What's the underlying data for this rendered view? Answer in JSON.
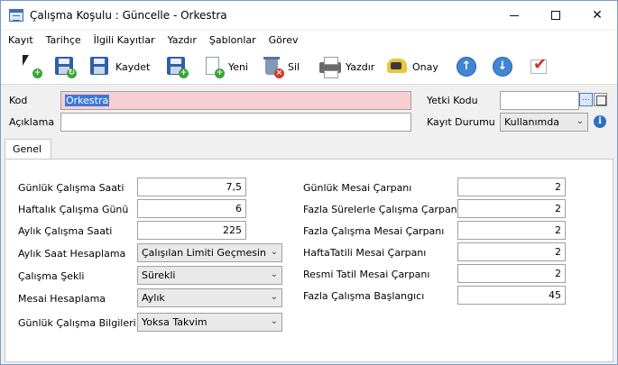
{
  "window": {
    "title": "Çalışma Koşulu : Güncelle - Orkestra",
    "min_icon": "minimize-icon",
    "max_icon": "maximize-icon",
    "close_icon": "close-icon"
  },
  "menu": [
    "Kayıt",
    "Tarihçe",
    "İlgili Kayıtlar",
    "Yazdır",
    "Şablonlar",
    "Görev"
  ],
  "toolbar": {
    "kaydet": "Kaydet",
    "yeni": "Yeni",
    "sil": "Sil",
    "yazdir": "Yazdır",
    "onay": "Onay"
  },
  "header": {
    "kod_label": "Kod",
    "kod_value": "Orkestra",
    "aciklama_label": "Açıklama",
    "aciklama_value": "",
    "yetki_label": "Yetki Kodu",
    "yetki_value": "",
    "durum_label": "Kayıt Durumu",
    "durum_value": "Kullanımda",
    "ellipsis": "...",
    "info": "i"
  },
  "tab": "Genel",
  "left": {
    "gunluk_saat_label": "Günlük Çalışma Saati",
    "gunluk_saat_value": "7,5",
    "haftalik_gun_label": "Haftalık Çalışma Günü",
    "haftalik_gun_value": "6",
    "aylik_saat_label": "Aylık Çalışma Saati",
    "aylik_saat_value": "225",
    "aylik_hesap_label": "Aylık Saat Hesaplama",
    "aylik_hesap_value": "Çalışılan Limiti Geçmesin",
    "calisma_sekli_label": "Çalışma Şekli",
    "calisma_sekli_value": "Sürekli",
    "mesai_hesap_label": "Mesai Hesaplama",
    "mesai_hesap_value": "Aylık",
    "gunluk_bilgi_label": "Günlük Çalışma Bilgileri",
    "gunluk_bilgi_value": "Yoksa Takvim"
  },
  "right": {
    "gunluk_mesai_label": "Günlük Mesai Çarpanı",
    "gunluk_mesai_value": "2",
    "fazla_sure_label": "Fazla Sürelerle Çalışma Çarpanı",
    "fazla_sure_value": "2",
    "fazla_mesai_label": "Fazla Çalışma Mesai Çarpanı",
    "fazla_mesai_value": "2",
    "hafta_tatili_label": "HaftaTatili Mesai Çarpanı",
    "hafta_tatili_value": "2",
    "resmi_tatil_label": "Resmi Tatil Mesai Çarpanı",
    "resmi_tatil_value": "2",
    "fazla_baslangic_label": "Fazla Çalışma Başlangıcı",
    "fazla_baslangic_value": "45"
  }
}
